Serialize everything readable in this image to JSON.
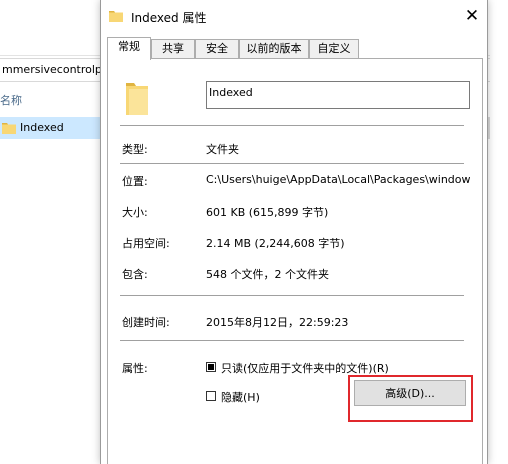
{
  "background": {
    "address_text": "mmersivecontrolpa",
    "column_header": "名称",
    "selected_item": "Indexed"
  },
  "dialog": {
    "title": "Indexed 属性",
    "close_glyph": "✕",
    "tabs": [
      {
        "label": "常规",
        "active": true
      },
      {
        "label": "共享",
        "active": false
      },
      {
        "label": "安全",
        "active": false
      },
      {
        "label": "以前的版本",
        "active": false
      },
      {
        "label": "自定义",
        "active": false
      }
    ],
    "name_value": "Indexed",
    "props": {
      "type_label": "类型:",
      "type_value": "文件夹",
      "location_label": "位置:",
      "location_value": "C:\\Users\\huige\\AppData\\Local\\Packages\\window",
      "size_label": "大小:",
      "size_value": "601 KB (615,899 字节)",
      "disk_label": "占用空间:",
      "disk_value": "2.14 MB (2,244,608 字节)",
      "contains_label": "包含:",
      "contains_value": "548 个文件，2 个文件夹",
      "created_label": "创建时间:",
      "created_value": "2015年8月12日，22:59:23",
      "attributes_label": "属性:"
    },
    "attributes": {
      "readonly_label": "只读(仅应用于文件夹中的文件)(R)",
      "readonly_checked": true,
      "hidden_label": "隐藏(H)",
      "hidden_checked": false
    },
    "advanced_button": "高级(D)..."
  },
  "colors": {
    "folder_yellow": "#f8d775",
    "folder_dark": "#e0b441",
    "selection_blue": "#cce8ff",
    "highlight_red": "#e0282c"
  },
  "icons": [
    "folder-icon",
    "close-icon",
    "checkbox-icon"
  ]
}
